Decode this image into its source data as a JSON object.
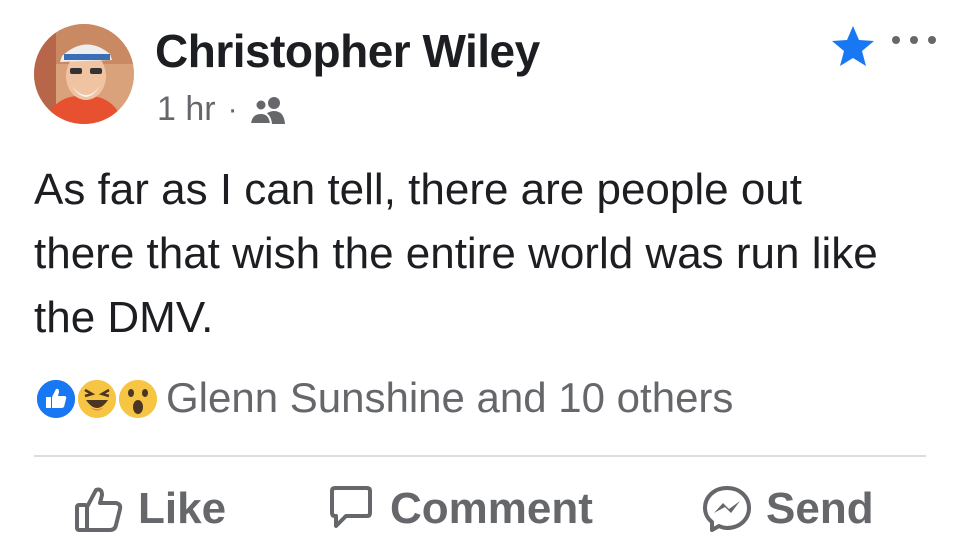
{
  "post": {
    "author": "Christopher Wiley",
    "time": "1 hr",
    "separator": "·",
    "audience_icon": "friends-icon",
    "body": "As far as I can tell, there are people out there that wish the entire world was run like the DMV.",
    "reactions": {
      "icons": [
        "like-reaction-icon",
        "haha-reaction-icon",
        "wow-reaction-icon"
      ],
      "summary": "Glenn Sunshine and 10 others"
    },
    "actions": {
      "like_label": "Like",
      "comment_label": "Comment",
      "send_label": "Send"
    }
  },
  "colors": {
    "text_primary": "#1c1e21",
    "text_secondary": "#65676b",
    "facebook_blue": "#1877f2",
    "haha_yellow": "#f7c544",
    "divider": "#dadde1"
  }
}
